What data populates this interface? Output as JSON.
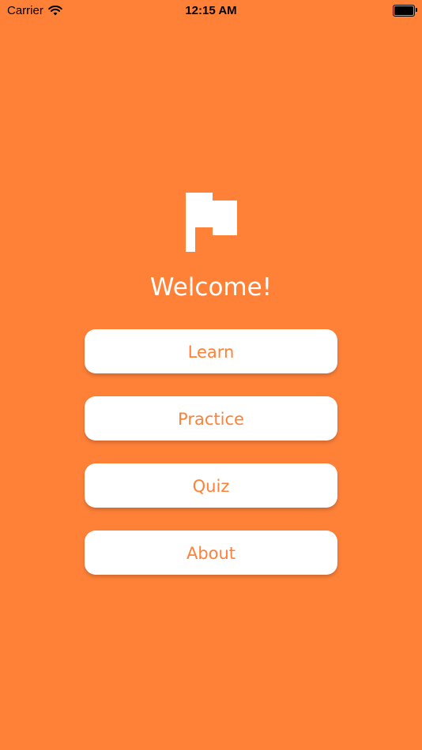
{
  "status_bar": {
    "carrier": "Carrier",
    "time": "12:15 AM",
    "wifi_icon": "wifi-icon",
    "battery_icon": "battery-icon"
  },
  "logo": {
    "icon": "flag-icon"
  },
  "title": "Welcome!",
  "menu": {
    "buttons": [
      {
        "label": "Learn"
      },
      {
        "label": "Practice"
      },
      {
        "label": "Quiz"
      },
      {
        "label": "About"
      }
    ]
  },
  "colors": {
    "background": "#FF8138",
    "button_background": "#FFFFFF",
    "button_text": "#FF8138"
  }
}
